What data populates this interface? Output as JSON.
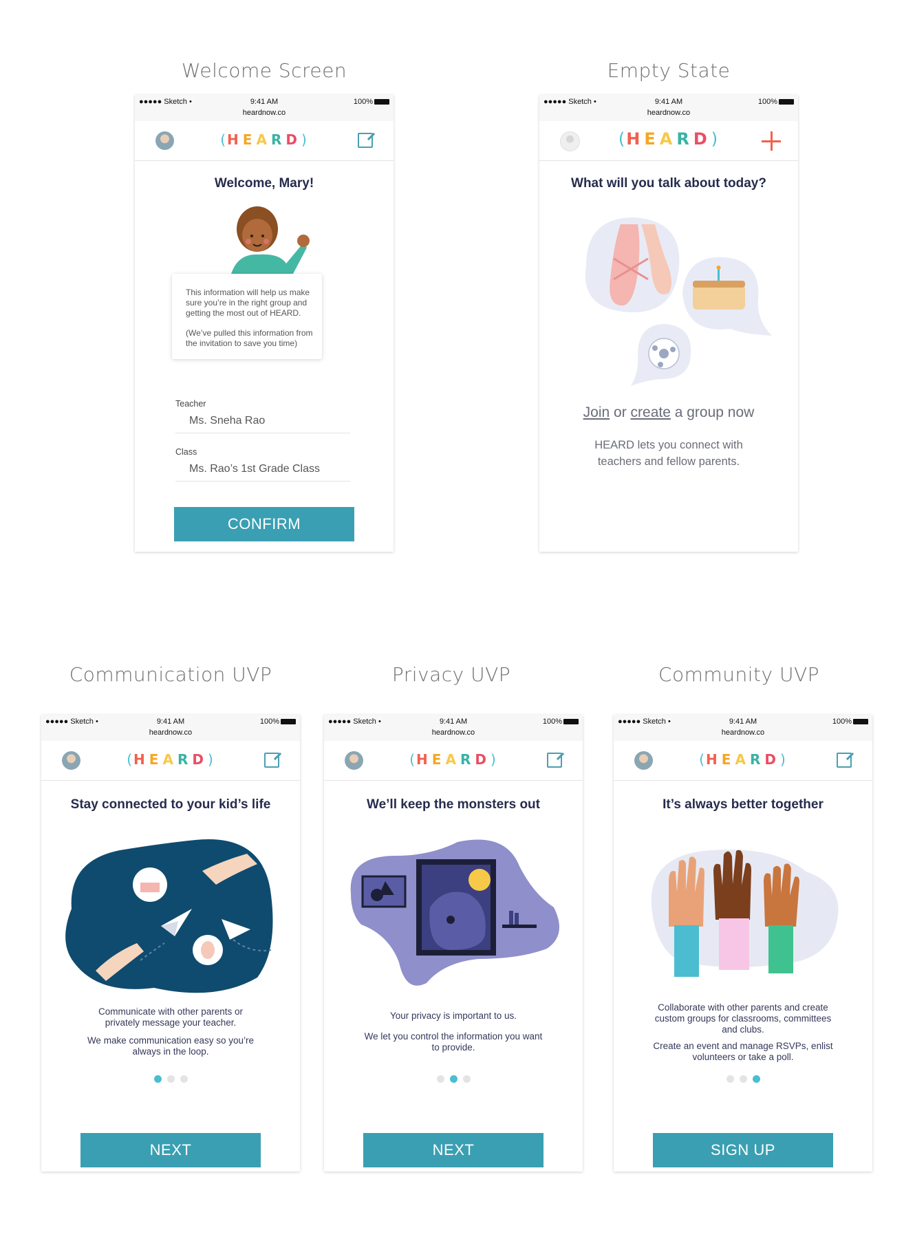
{
  "status_bar": {
    "carrier": "●●●●● Sketch •",
    "time": "9:41 AM",
    "url": "heardnow.co",
    "battery": "100%"
  },
  "logo": {
    "left": "(",
    "letters": [
      "H",
      "E",
      "A",
      "R",
      "D"
    ],
    "right": ")"
  },
  "logo_colors": [
    "#f2604d",
    "#f6a623",
    "#f7c948",
    "#38b3a4",
    "#e94f64"
  ],
  "colors": {
    "accent": "#3a9fb2",
    "brand_teal": "#4bbdd1",
    "plus": "#f2604d",
    "heading": "#262c4d"
  },
  "welcome": {
    "screen_title": "Welcome Screen",
    "heading": "Welcome, Mary!",
    "info_p1": "This information will help us make sure you’re in the right group and getting the most out of HEARD.",
    "info_p2": "(We’ve pulled this information from the invitation to save you time)",
    "teacher_label": "Teacher",
    "teacher_value": "Ms. Sneha Rao",
    "class_label": "Class",
    "class_value": "Ms. Rao’s 1st Grade Class",
    "button": "CONFIRM"
  },
  "empty": {
    "screen_title": "Empty State",
    "heading": "What will you talk about today?",
    "join": "Join",
    "or": " or ",
    "create": "create",
    "rest": " a group now",
    "desc": "HEARD lets you connect with teachers and fellow parents."
  },
  "communication": {
    "screen_title": "Communication UVP",
    "heading": "Stay connected to your kid’s life",
    "p1": "Communicate with other parents or privately message your teacher.",
    "p2": "We make communication easy so you’re always in the loop.",
    "button": "NEXT",
    "active_dot": 0
  },
  "privacy": {
    "screen_title": "Privacy UVP",
    "heading": "We’ll keep the monsters out",
    "p1": "Your privacy is important to us.",
    "p2": "We let you control the information you want to provide.",
    "button": "NEXT",
    "active_dot": 1
  },
  "community": {
    "screen_title": "Community UVP",
    "heading": "It’s always better together",
    "p1": "Collaborate with other parents and create custom groups for classrooms, committees and clubs.",
    "p2": "Create an event and manage RSVPs, enlist volunteers or take a poll.",
    "button": "SIGN UP",
    "active_dot": 2
  }
}
